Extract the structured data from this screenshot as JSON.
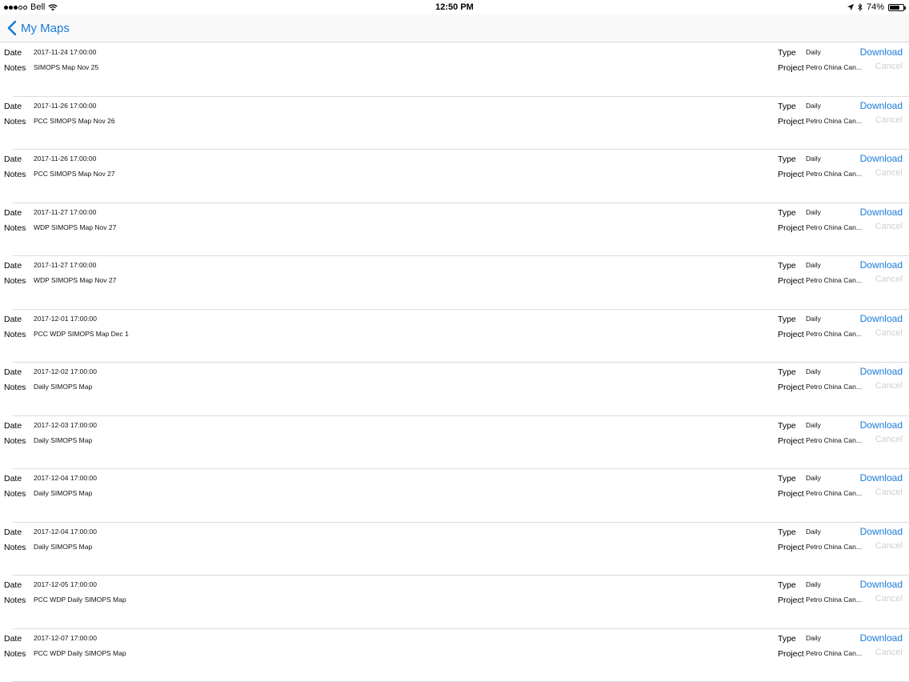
{
  "status_bar": {
    "carrier": "Bell",
    "time": "12:50 PM",
    "battery": "74%",
    "battery_level": 0.74
  },
  "nav": {
    "back_label": "My Maps"
  },
  "labels": {
    "date": "Date",
    "notes": "Notes",
    "type": "Type",
    "project": "Project",
    "download": "Download",
    "cancel": "Cancel"
  },
  "maps": [
    {
      "date": "2017-11-24 17:00:00",
      "notes": "SIMOPS Map Nov 25",
      "type": "Daily",
      "project": "Petro China Can..."
    },
    {
      "date": "2017-11-26 17:00:00",
      "notes": "PCC SIMOPS Map Nov 26",
      "type": "Daily",
      "project": "Petro China Can..."
    },
    {
      "date": "2017-11-26 17:00:00",
      "notes": "PCC SIMOPS Map Nov 27",
      "type": "Daily",
      "project": "Petro China Can..."
    },
    {
      "date": "2017-11-27 17:00:00",
      "notes": "WDP SIMOPS Map Nov 27",
      "type": "Daily",
      "project": "Petro China Can..."
    },
    {
      "date": "2017-11-27 17:00:00",
      "notes": "WDP SIMOPS Map Nov 27",
      "type": "Daily",
      "project": "Petro China Can..."
    },
    {
      "date": "2017-12-01 17:00:00",
      "notes": "PCC WDP SIMOPS Map Dec 1",
      "type": "Daily",
      "project": "Petro China Can..."
    },
    {
      "date": "2017-12-02 17:00:00",
      "notes": "Daily SIMOPS Map",
      "type": "Daily",
      "project": "Petro China Can..."
    },
    {
      "date": "2017-12-03 17:00:00",
      "notes": "Daily SIMOPS Map",
      "type": "Daily",
      "project": "Petro China Can..."
    },
    {
      "date": "2017-12-04 17:00:00",
      "notes": "Daily SIMOPS Map",
      "type": "Daily",
      "project": "Petro China Can..."
    },
    {
      "date": "2017-12-04 17:00:00",
      "notes": "Daily SIMOPS Map",
      "type": "Daily",
      "project": "Petro China Can..."
    },
    {
      "date": "2017-12-05 17:00:00",
      "notes": "PCC WDP Daily SIMOPS Map",
      "type": "Daily",
      "project": "Petro China Can..."
    },
    {
      "date": "2017-12-07 17:00:00",
      "notes": "PCC WDP Daily SIMOPS Map",
      "type": "Daily",
      "project": "Petro China Can..."
    }
  ],
  "colors": {
    "accent": "#1a7ad8",
    "disabled": "#cfcfcf"
  }
}
